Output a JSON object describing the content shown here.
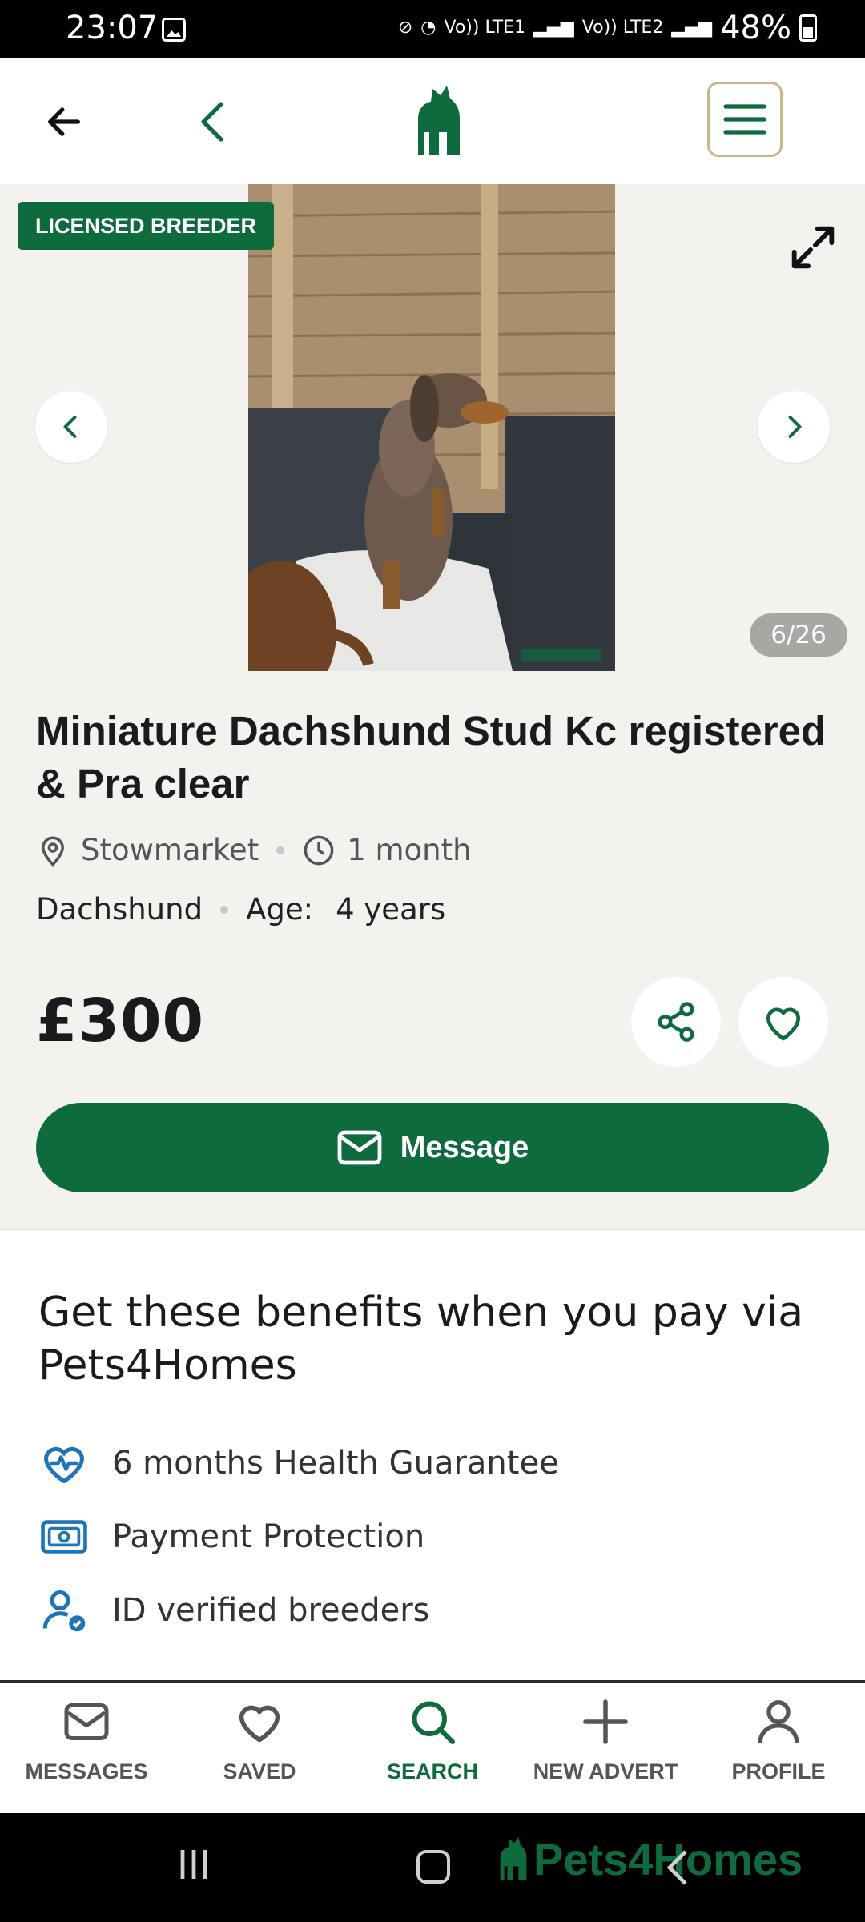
{
  "status_bar": {
    "time": "23:07",
    "network_1": "Vo)) LTE1",
    "network_2": "Vo)) LTE2",
    "battery": "48%"
  },
  "header": {
    "logo": "pets4homes-logo",
    "back_icon": "arrow-left-icon",
    "chevron_icon": "chevron-left-icon",
    "menu_icon": "hamburger-menu-icon"
  },
  "gallery": {
    "badge": "LICENSED BREEDER",
    "counter": "6/26",
    "image": "miniature-dachshund-photo"
  },
  "listing": {
    "title": "Miniature Dachshund Stud Kc registered & Pra clear",
    "location": "Stowmarket",
    "posted": "1 month",
    "breed": "Dachshund",
    "age_label": "Age:",
    "age_value": "4 years",
    "price": "£300",
    "message_label": "Message"
  },
  "benefits": {
    "title": "Get these benefits when you pay via Pets4Homes",
    "items": [
      {
        "label": "6 months Health Guarantee",
        "icon": "heart-pulse-icon"
      },
      {
        "label": "Payment Protection",
        "icon": "money-icon"
      },
      {
        "label": "ID verified breeders",
        "icon": "verified-user-icon"
      }
    ]
  },
  "bottom_nav": {
    "items": [
      {
        "label": "MESSAGES",
        "icon": "mail-icon"
      },
      {
        "label": "SAVED",
        "icon": "heart-icon"
      },
      {
        "label": "SEARCH",
        "icon": "search-icon",
        "active": true
      },
      {
        "label": "NEW ADVERT",
        "icon": "plus-icon"
      },
      {
        "label": "PROFILE",
        "icon": "user-icon"
      }
    ]
  },
  "watermark": "Pets4Homes",
  "colors": {
    "brand_green": "#0d6b3d",
    "background": "#f3f2ef",
    "menu_border": "#c9b58a",
    "benefit_icon_blue": "#1d74b8"
  }
}
